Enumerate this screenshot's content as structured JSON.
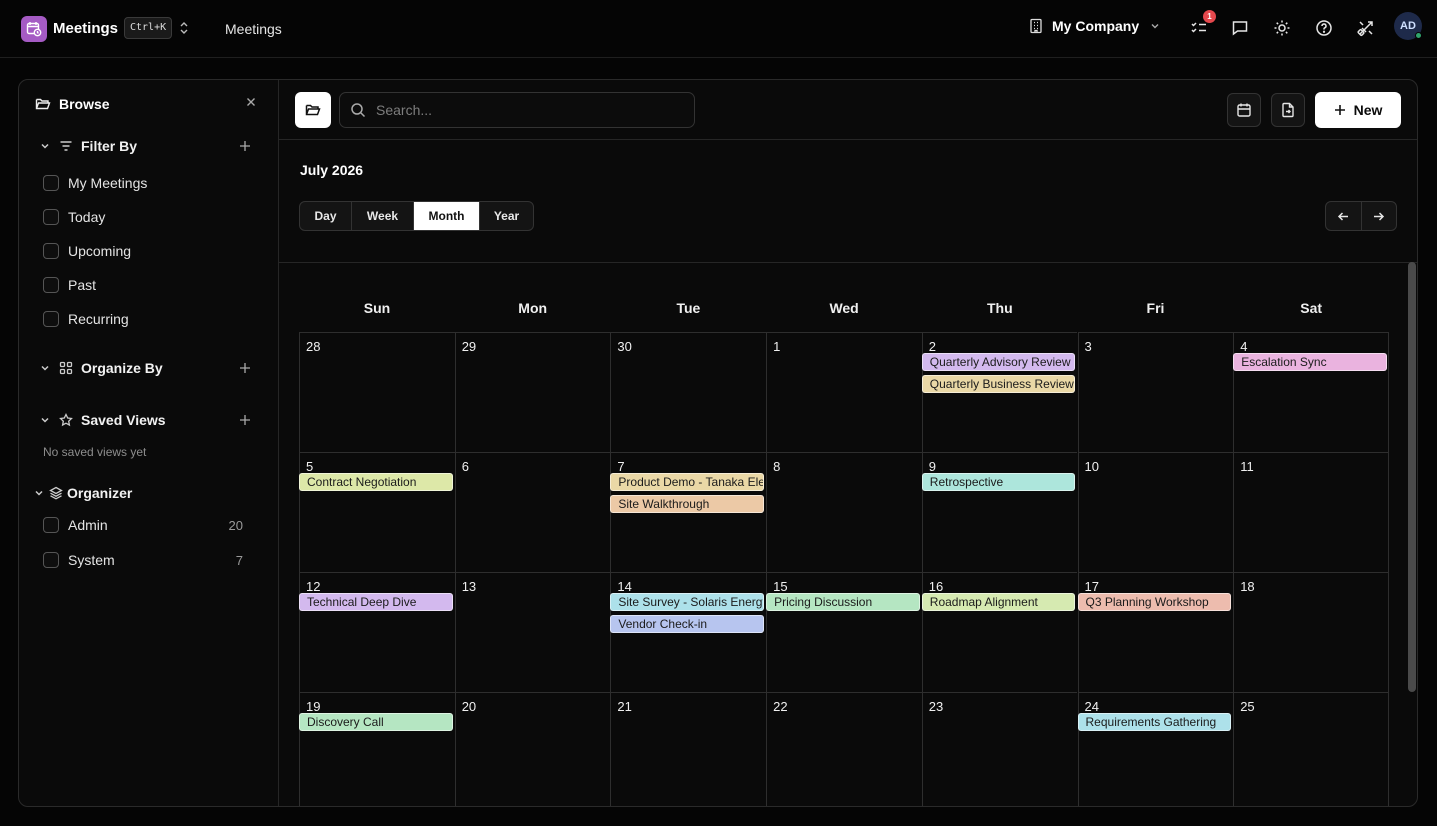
{
  "topbar": {
    "app_name": "Meetings",
    "shortcut": "Ctrl+K",
    "breadcrumb": "Meetings",
    "company": "My Company",
    "notification_count": "1",
    "avatar_initials": "AD"
  },
  "sidebar": {
    "title": "Browse",
    "filter_by": "Filter By",
    "filters": [
      "My Meetings",
      "Today",
      "Upcoming",
      "Past",
      "Recurring"
    ],
    "organize_by": "Organize By",
    "saved_views": "Saved Views",
    "no_saved_views": "No saved views yet",
    "organizer": "Organizer",
    "organizers": [
      {
        "name": "Admin",
        "count": "20"
      },
      {
        "name": "System",
        "count": "7"
      }
    ]
  },
  "toolbar": {
    "search_placeholder": "Search...",
    "new_label": "New"
  },
  "calendar": {
    "month_label": "July 2026",
    "views": [
      "Day",
      "Week",
      "Month",
      "Year"
    ],
    "active_view": "Month",
    "weekdays": [
      "Sun",
      "Mon",
      "Tue",
      "Wed",
      "Thu",
      "Fri",
      "Sat"
    ],
    "weeks": [
      [
        "28",
        "29",
        "30",
        "1",
        "2",
        "3",
        "4"
      ],
      [
        "5",
        "6",
        "7",
        "8",
        "9",
        "10",
        "11"
      ],
      [
        "12",
        "13",
        "14",
        "15",
        "16",
        "17",
        "18"
      ],
      [
        "19",
        "20",
        "21",
        "22",
        "23",
        "24",
        "25"
      ]
    ],
    "events": [
      {
        "title": "Quarterly Advisory Review",
        "week": 0,
        "day": 4,
        "slot": 0,
        "color": "#d3b9ee"
      },
      {
        "title": "Quarterly Business Review",
        "week": 0,
        "day": 4,
        "slot": 1,
        "color": "#ead8a6"
      },
      {
        "title": "Escalation Sync",
        "week": 0,
        "day": 6,
        "slot": 0,
        "color": "#eab3df"
      },
      {
        "title": "Contract Negotiation",
        "week": 1,
        "day": 0,
        "slot": 0,
        "color": "#dde8a8"
      },
      {
        "title": "Product Demo - Tanaka Electronics",
        "week": 1,
        "day": 2,
        "slot": 0,
        "color": "#ead8a6"
      },
      {
        "title": "Site Walkthrough",
        "week": 1,
        "day": 2,
        "slot": 1,
        "color": "#ecc9a6"
      },
      {
        "title": "Retrospective",
        "week": 1,
        "day": 4,
        "slot": 0,
        "color": "#ade6dc"
      },
      {
        "title": "Technical Deep Dive",
        "week": 2,
        "day": 0,
        "slot": 0,
        "color": "#d3b9ee"
      },
      {
        "title": "Site Survey - Solaris Energy",
        "week": 2,
        "day": 2,
        "slot": 0,
        "color": "#ade1ea"
      },
      {
        "title": "Vendor Check-in",
        "week": 2,
        "day": 2,
        "slot": 1,
        "color": "#b7c5ef"
      },
      {
        "title": "Pricing Discussion",
        "week": 2,
        "day": 3,
        "slot": 0,
        "color": "#b5e6c2"
      },
      {
        "title": "Roadmap Alignment",
        "week": 2,
        "day": 4,
        "slot": 0,
        "color": "#d6eab1"
      },
      {
        "title": "Q3 Planning Workshop",
        "week": 2,
        "day": 5,
        "slot": 0,
        "color": "#edbcae"
      },
      {
        "title": "Discovery Call",
        "week": 3,
        "day": 0,
        "slot": 0,
        "color": "#b5e6c2"
      },
      {
        "title": "Requirements Gathering",
        "week": 3,
        "day": 5,
        "slot": 0,
        "color": "#ade1ea"
      }
    ]
  }
}
